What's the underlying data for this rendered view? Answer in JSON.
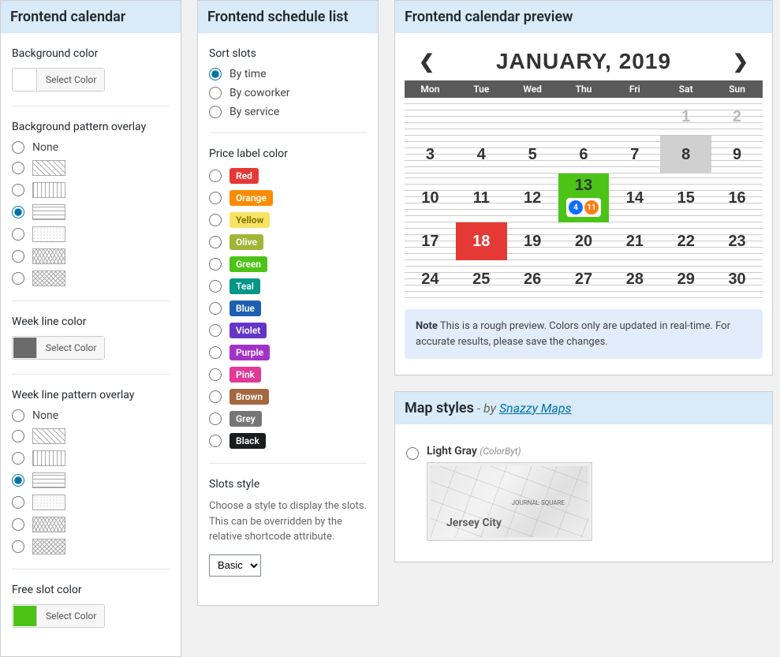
{
  "panels": {
    "frontend_calendar": "Frontend calendar",
    "frontend_schedule": "Frontend schedule list",
    "frontend_preview": "Frontend calendar preview",
    "map_styles": "Map styles",
    "map_by_prefix": " - by ",
    "map_by_link": "Snazzy Maps"
  },
  "fc": {
    "bg_color_label": "Background color",
    "select_color": "Select Color",
    "bg_pattern_label": "Background pattern overlay",
    "none": "None",
    "week_line_color_label": "Week line color",
    "week_line_color": "#6b6b6b",
    "week_line_pattern_label": "Week line pattern overlay",
    "free_slot_label": "Free slot color",
    "free_slot_color": "#4cc417"
  },
  "fs": {
    "sort_label": "Sort slots",
    "sort_options": {
      "time": "By time",
      "coworker": "By coworker",
      "service": "By service"
    },
    "price_label": "Price label color",
    "colors": {
      "red": {
        "label": "Red",
        "bg": "#e53935"
      },
      "orange": {
        "label": "Orange",
        "bg": "#fb8c00"
      },
      "yellow": {
        "label": "Yellow",
        "bg": "#f7e463",
        "fg": "#7a6a00"
      },
      "olive": {
        "label": "Olive",
        "bg": "#a0b636"
      },
      "green": {
        "label": "Green",
        "bg": "#4cc417"
      },
      "teal": {
        "label": "Teal",
        "bg": "#009688"
      },
      "blue": {
        "label": "Blue",
        "bg": "#1e5fb3"
      },
      "violet": {
        "label": "Violet",
        "bg": "#6435c9"
      },
      "purple": {
        "label": "Purple",
        "bg": "#a333c8"
      },
      "pink": {
        "label": "Pink",
        "bg": "#e03997"
      },
      "brown": {
        "label": "Brown",
        "bg": "#a5673f"
      },
      "grey": {
        "label": "Grey",
        "bg": "#767676"
      },
      "black": {
        "label": "Black",
        "bg": "#1b1c1d"
      }
    },
    "slots_style_label": "Slots style",
    "slots_style_desc": "Choose a style to display the slots. This can be overridden by the relative shortcode attribute.",
    "slots_style_value": "Basic"
  },
  "preview": {
    "month": "JANUARY, 2019",
    "dow": [
      "Mon",
      "Tue",
      "Wed",
      "Thu",
      "Fri",
      "Sat",
      "Sun"
    ],
    "weeks": [
      [
        null,
        "1",
        "2",
        "3",
        "4",
        "5",
        "6"
      ],
      [
        "7",
        "8",
        "9",
        "10",
        "11",
        "12",
        "13"
      ],
      [
        "14",
        "15",
        "16",
        "17",
        "18",
        "19",
        "20"
      ],
      [
        "21",
        "22",
        "23",
        "24",
        "25",
        "26",
        "27"
      ],
      [
        "28",
        "29",
        "30",
        null,
        null,
        null,
        null
      ]
    ],
    "dim_days": [
      "1",
      "2"
    ],
    "grey_day": "8",
    "green_day": "13",
    "red_day": "18",
    "badges": [
      "4",
      "11"
    ],
    "note_label": "Note",
    "note_text": " This is a rough preview. Colors only are updated in real-time. For accurate results, please save the changes."
  },
  "map": {
    "option_name": "Light Gray",
    "option_author": "(ColorByt)",
    "city_label": "Jersey City",
    "area_label": "JOURNAL SQUARE"
  }
}
